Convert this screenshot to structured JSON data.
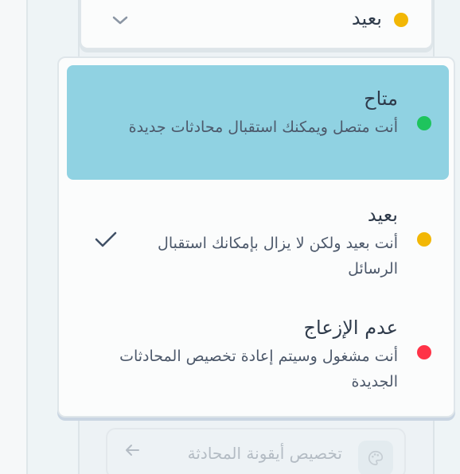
{
  "colors": {
    "available": "#1ec45d",
    "away": "#f2b705",
    "busy": "#ff3347",
    "highlight": "#90d2e2",
    "text_primary": "#2f3b4b",
    "text_secondary": "#4d596b"
  },
  "status_select": {
    "current_label": "بعيد",
    "current_color": "#f2b705",
    "chevron_icon": "chevron-down-icon"
  },
  "options": [
    {
      "title": "متاح",
      "description": "أنت متصل ويمكنك استقبال محادثات جديدة",
      "color": "#1ec45d",
      "highlighted": true,
      "checked": false
    },
    {
      "title": "بعيد",
      "description": "أنت بعيد ولكن لا يزال بإمكانك استقبال الرسائل",
      "color": "#f2b705",
      "highlighted": false,
      "checked": true
    },
    {
      "title": "عدم الإزعاج",
      "description": "أنت مشغول وسيتم إعادة تخصيص المحادثات الجديدة",
      "color": "#ff3347",
      "highlighted": false,
      "checked": false
    }
  ],
  "bottom_action": {
    "label": "تخصيص أيقونة المحادثة",
    "icon": "palette-icon",
    "arrow_icon": "arrow-left-icon"
  }
}
